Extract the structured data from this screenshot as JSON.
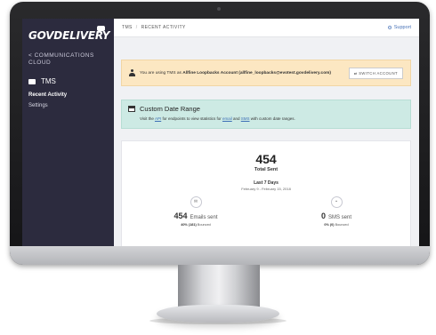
{
  "sidebar": {
    "logo_text": "GOVDELIVERY",
    "back_link": "< COMMUNICATIONS CLOUD",
    "section": "TMS",
    "items": [
      {
        "label": "Recent Activity",
        "active": true
      },
      {
        "label": "Settings",
        "active": false
      }
    ]
  },
  "topbar": {
    "crumbs": [
      "TMS",
      "RECENT ACTIVITY"
    ],
    "support_label": "Support"
  },
  "banner": {
    "prefix": "You are using TMS as ",
    "account": "Allfine Loopbacks Account (allfine_loopbacks@evotest.govdelivery.com)",
    "switch_label": "⇄ SWITCH ACCOUNT"
  },
  "date_range": {
    "title": "Custom Date Range",
    "text_1": "Visit the ",
    "api_link": "API",
    "text_2": " for endpoints to view statistics for ",
    "email_link": "email",
    "text_3": " and ",
    "sms_link": "SMS",
    "text_4": " with custom date ranges."
  },
  "stats": {
    "total": "454",
    "total_label": "Total Sent",
    "period": "Last 7 Days",
    "period_range": "February 9 - February 15, 2018",
    "email": {
      "count": "454",
      "label": "Emails sent",
      "sub_pct": "40% (181)",
      "sub_label": "Bounced"
    },
    "sms": {
      "count": "0",
      "label": "SMS sent",
      "sub_pct": "0% (0)",
      "sub_label": "Bounced"
    }
  },
  "icons": {
    "person": "person-icon",
    "calendar": "calendar-icon",
    "email": "envelope-icon",
    "sms": "chat-icon",
    "support": "gear-icon"
  },
  "colors": {
    "sidebar": "#2c2b3e",
    "banner": "#fce7c2",
    "date_range": "#cdeae4",
    "link": "#3d6fb6"
  }
}
